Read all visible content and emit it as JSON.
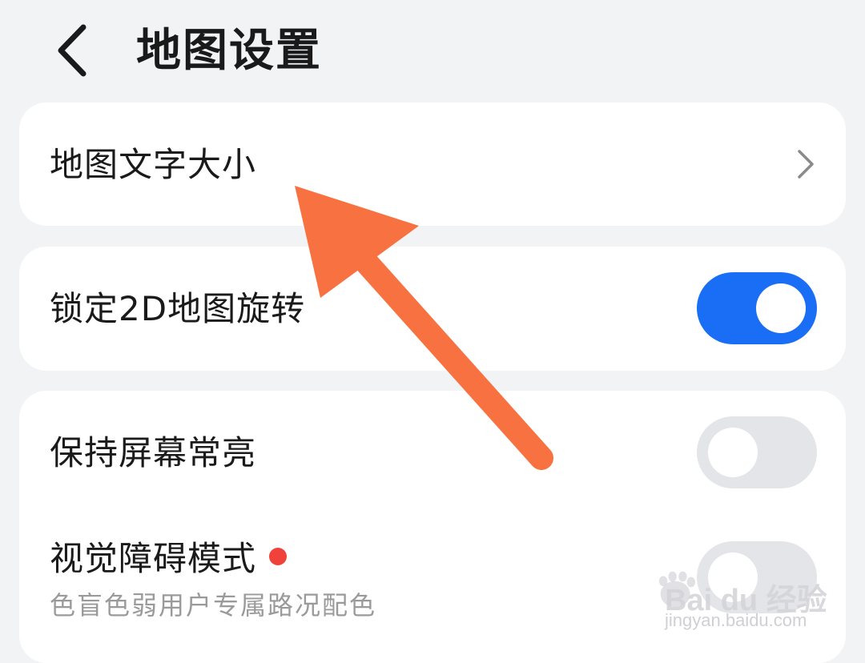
{
  "header": {
    "title": "地图设置",
    "back_icon": "chevron-left-icon"
  },
  "settings": {
    "font_size": {
      "label": "地图文字大小",
      "icon": "chevron-right-icon"
    },
    "lock_2d": {
      "label": "锁定2D地图旋转",
      "toggle": "on"
    },
    "keep_screen_on": {
      "label": "保持屏幕常亮",
      "toggle": "off"
    },
    "visual_impairment": {
      "label": "视觉障碍模式",
      "subtitle": "色盲色弱用户专属路况配色",
      "badge": "red-dot",
      "toggle": "off"
    }
  },
  "annotation": {
    "type": "arrow",
    "color": "#f87241",
    "points_to": "地图文字大小"
  },
  "watermark": {
    "brand": "Bai du 经验",
    "url": "jingyan.baidu.com"
  },
  "colors": {
    "toggle_on": "#1a6ef5",
    "toggle_off": "#e4e5e9",
    "background": "#f1f3f5",
    "badge": "#f0413a"
  }
}
